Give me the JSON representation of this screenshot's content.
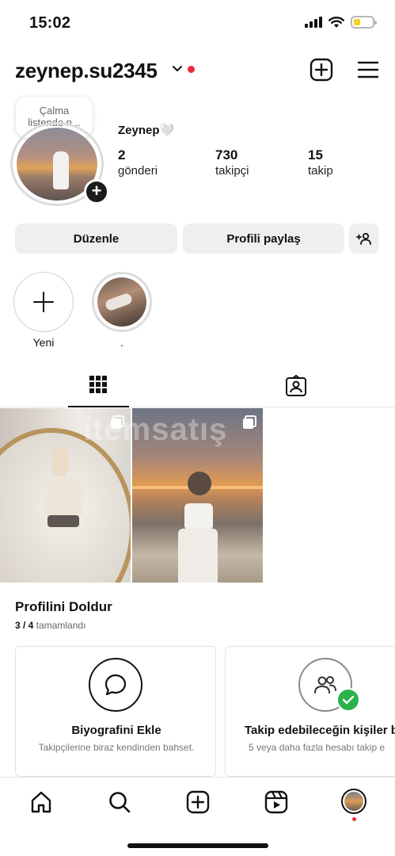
{
  "status_bar": {
    "time": "15:02",
    "battery_level": 0.35,
    "battery_color": "#f5d01c"
  },
  "header": {
    "username": "zeynep.su2345",
    "icons": [
      "chevron-down-icon",
      "new-post-icon",
      "menu-icon"
    ],
    "notification_color": "#ef2b3a"
  },
  "profile": {
    "note": "Çalma listende n...",
    "display_name": "Zeynep",
    "heart": "🤍",
    "stats": [
      {
        "value": "2",
        "label": "gönderi"
      },
      {
        "value": "730",
        "label": "takipçi"
      },
      {
        "value": "15",
        "label": "takip"
      }
    ]
  },
  "actions": {
    "edit": "Düzenle",
    "share": "Profili paylaş",
    "discover_icon": "add-person-icon"
  },
  "highlights": [
    {
      "label": "Yeni"
    },
    {
      "label": "."
    }
  ],
  "tabs": [
    {
      "icon": "grid-icon",
      "active": true
    },
    {
      "icon": "tagged-icon",
      "active": false
    }
  ],
  "posts": [
    {
      "type": "carousel"
    },
    {
      "type": "carousel"
    }
  ],
  "watermark": "itemsatış",
  "complete_profile": {
    "title": "Profilini Doldur",
    "progress": "3 / 4",
    "progress_text": "tamamlandı",
    "cards": [
      {
        "icon": "chat-bubble-icon",
        "title": "Biyografini Ekle",
        "desc": "Takipçilerine biraz kendinden bahset.",
        "done": false
      },
      {
        "icon": "people-icon",
        "title": "Takip edebileceğin kişiler b",
        "desc": "5 veya daha fazla hesabı takip e",
        "done": true
      }
    ]
  },
  "bottom_nav": [
    "home-icon",
    "search-icon",
    "create-icon",
    "reels-icon",
    "profile-avatar"
  ],
  "colors": {
    "accent_green": "#2bb24c",
    "button_bg": "#efefef"
  }
}
